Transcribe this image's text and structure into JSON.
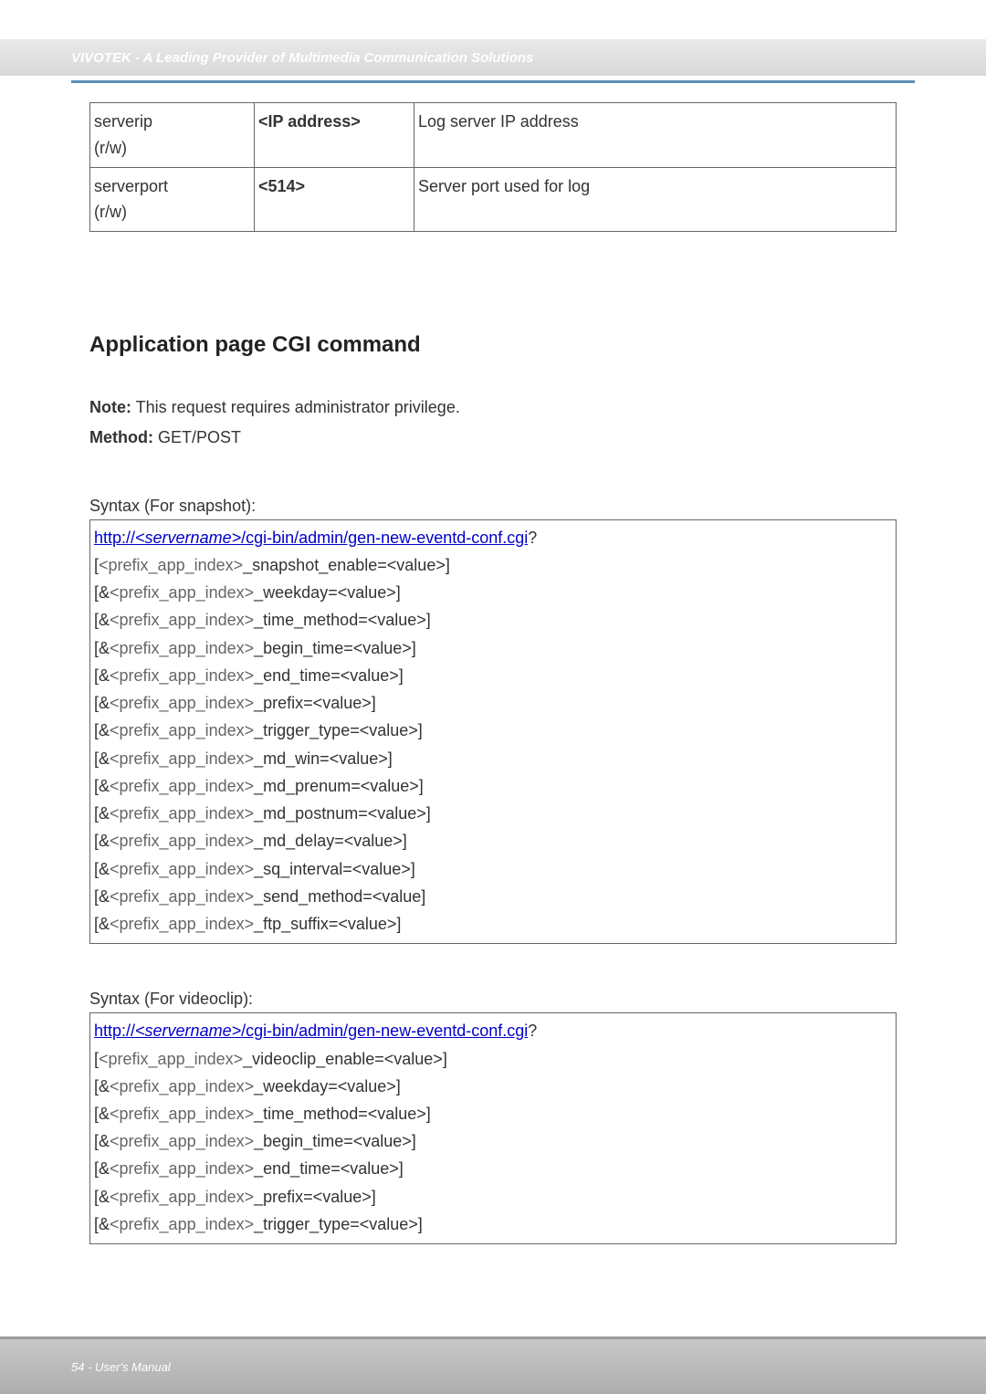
{
  "header": {
    "brand": "VIVOTEK - A Leading Provider of Multimedia Communication Solutions"
  },
  "table": {
    "rows": [
      {
        "name": "serverip",
        "rw": "(r/w)",
        "value": "<IP address>",
        "desc": "Log server IP address"
      },
      {
        "name": "serverport",
        "rw": "(r/w)",
        "value": "<514>",
        "desc": "Server port used for log"
      }
    ]
  },
  "section": {
    "title": "Application page CGI command",
    "note_label": "Note:",
    "note_text": " This request requires administrator privilege.",
    "method_label": "Method:",
    "method_text": " GET/POST"
  },
  "syntax1": {
    "label": "Syntax (For snapshot):",
    "url_part1": "http://",
    "url_server": "<servername>",
    "url_part2": "/cgi-bin/admin/gen-new-eventd-conf.cgi",
    "q": "?",
    "lines": [
      {
        "prefix": "[",
        "param": "<prefix_app_index>",
        "suffix": "_snapshot_enable=<value>]"
      },
      {
        "prefix": "[&",
        "param": "<prefix_app_index>",
        "suffix": "_weekday=<value>]"
      },
      {
        "prefix": "[&",
        "param": "<prefix_app_index>",
        "suffix": "_time_method=<value>]"
      },
      {
        "prefix": "[&",
        "param": "<prefix_app_index>",
        "suffix": "_begin_time=<value>]"
      },
      {
        "prefix": "[&",
        "param": "<prefix_app_index>",
        "suffix": "_end_time=<value>]"
      },
      {
        "prefix": "[&",
        "param": "<prefix_app_index>",
        "suffix": "_prefix=<value>]"
      },
      {
        "prefix": "[&",
        "param": "<prefix_app_index>",
        "suffix": "_trigger_type=<value>]"
      },
      {
        "prefix": "[&",
        "param": "<prefix_app_index>",
        "suffix": "_md_win=<value>]"
      },
      {
        "prefix": "[&",
        "param": "<prefix_app_index>",
        "suffix": "_md_prenum=<value>]"
      },
      {
        "prefix": "[&",
        "param": "<prefix_app_index>",
        "suffix": "_md_postnum=<value>]"
      },
      {
        "prefix": "[&",
        "param": "<prefix_app_index>",
        "suffix": "_md_delay=<value>]"
      },
      {
        "prefix": "[&",
        "param": "<prefix_app_index>",
        "suffix": "_sq_interval=<value>]"
      },
      {
        "prefix": "[&",
        "param": "<prefix_app_index>",
        "suffix": "_send_method=<value]"
      },
      {
        "prefix": "[&",
        "param": "<prefix_app_index>",
        "suffix": "_ftp_suffix=<value>]"
      }
    ]
  },
  "syntax2": {
    "label": "Syntax (For videoclip):",
    "url_part1": "http://",
    "url_server": "<servername>",
    "url_part2": "/cgi-bin/admin/gen-new-eventd-conf.cgi",
    "q": "?",
    "lines": [
      {
        "prefix": "[",
        "param": "<prefix_app_index>",
        "suffix": "_videoclip_enable=<value>]"
      },
      {
        "prefix": "[&",
        "param": "<prefix_app_index>",
        "suffix": "_weekday=<value>]"
      },
      {
        "prefix": "[&",
        "param": "<prefix_app_index>",
        "suffix": "_time_method=<value>]"
      },
      {
        "prefix": "[&",
        "param": "<prefix_app_index>",
        "suffix": "_begin_time=<value>]"
      },
      {
        "prefix": "[&",
        "param": "<prefix_app_index>",
        "suffix": "_end_time=<value>]"
      },
      {
        "prefix": "[&",
        "param": "<prefix_app_index>",
        "suffix": "_prefix=<value>]"
      },
      {
        "prefix": "[&",
        "param": "<prefix_app_index>",
        "suffix": "_trigger_type=<value>]"
      }
    ]
  },
  "footer": {
    "text": "54 - User's Manual"
  }
}
